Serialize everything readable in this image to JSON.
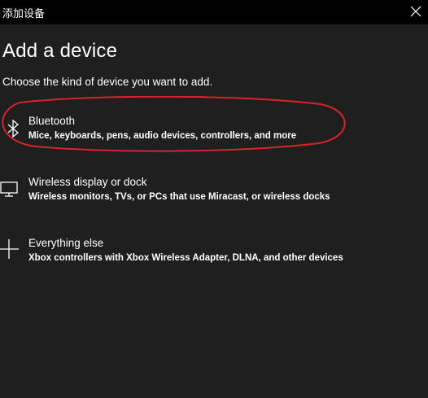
{
  "window": {
    "title": "添加设备"
  },
  "page": {
    "heading": "Add a device",
    "subtitle": "Choose the kind of device you want to add."
  },
  "options": [
    {
      "label": "Bluetooth",
      "description": "Mice, keyboards, pens, audio devices, controllers, and more",
      "icon": "bluetooth-icon"
    },
    {
      "label": "Wireless display or dock",
      "description": "Wireless monitors, TVs, or PCs that use Miracast, or wireless docks",
      "icon": "monitor-icon"
    },
    {
      "label": "Everything else",
      "description": "Xbox controllers with Xbox Wireless Adapter, DLNA, and other devices",
      "icon": "plus-icon"
    }
  ],
  "annotation": {
    "color": "#d9232a",
    "shape": "ellipse around Bluetooth option"
  },
  "colors": {
    "background": "#1f1f1f",
    "titlebar": "#000000",
    "text": "#ffffff"
  }
}
